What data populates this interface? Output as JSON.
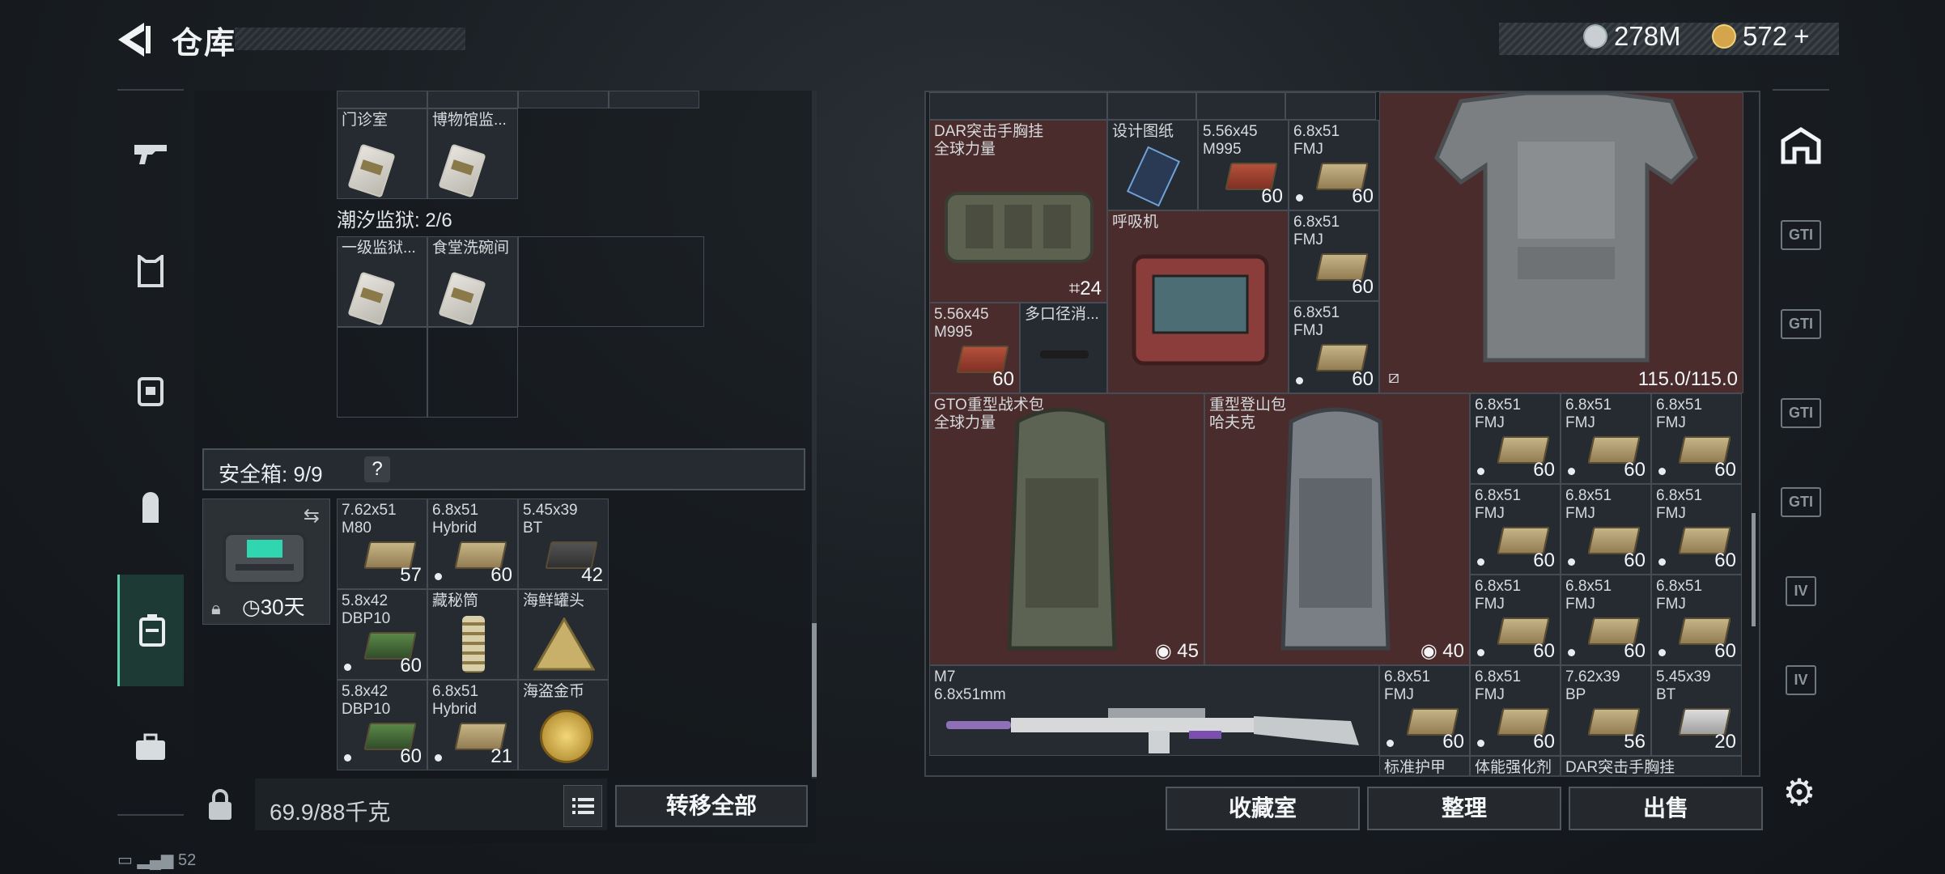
{
  "header": {
    "title": "仓库"
  },
  "currency": {
    "silver": "278M",
    "gold": "572",
    "gold_add": "+"
  },
  "leftnav": {
    "items": [
      "gun-icon",
      "armor-icon",
      "rig-icon",
      "backpack-icon",
      "case-icon",
      "toolbox-icon"
    ]
  },
  "left_panel": {
    "top_cells": [
      {
        "label": "门诊室"
      },
      {
        "label": "博物馆监..."
      }
    ],
    "group_title": "潮汐监狱: 2/6",
    "group_cells": [
      {
        "label": "一级监狱..."
      },
      {
        "label": "食堂洗碗间"
      }
    ],
    "safe_box": {
      "title": "安全箱: 9/9",
      "help": "?",
      "timer": "30天"
    },
    "safe_items": [
      {
        "label": "7.62x51\nM80",
        "count": "57",
        "dot": false
      },
      {
        "label": "6.8x51\nHybrid",
        "count": "60",
        "dot": true
      },
      {
        "label": "5.45x39\nBT",
        "count": "42",
        "dot": false
      },
      {
        "label": "5.8x42\nDBP10",
        "count": "60",
        "dot": true
      },
      {
        "label": "藏秘筒",
        "count": "",
        "dot": false
      },
      {
        "label": "海鲜罐头",
        "count": "",
        "dot": false
      },
      {
        "label": "5.8x42\nDBP10",
        "count": "60",
        "dot": true
      },
      {
        "label": "6.8x51\nHybrid",
        "count": "21",
        "dot": true
      },
      {
        "label": "海盗金币",
        "count": "",
        "dot": false
      }
    ],
    "weight": "69.9/88千克",
    "transfer_all": "转移全部"
  },
  "right_panel": {
    "top_row_labels": [],
    "chest_rig": {
      "label": "DAR突击手胸挂\n全球力量",
      "count": "24"
    },
    "blueprint": {
      "label": "设计图纸"
    },
    "ammo_m995_a": {
      "label": "5.56x45\nM995",
      "count": "60"
    },
    "fmj_1": {
      "label": "6.8x51\nFMJ",
      "count": "60"
    },
    "respirator": {
      "label": "呼吸机"
    },
    "fmj_2": {
      "label": "6.8x51\nFMJ",
      "count": "60"
    },
    "ammo_m995_b": {
      "label": "5.56x45\nM995",
      "count": "60"
    },
    "suppressor": {
      "label": "多口径消..."
    },
    "fmj_3": {
      "label": "6.8x51\nFMJ",
      "count": "60"
    },
    "armor": {
      "durability": "115.0/115.0"
    },
    "backpack_gto": {
      "label": "GTO重型战术包\n全球力量",
      "count": "45"
    },
    "backpack_hafuke": {
      "label": "重型登山包\n哈夫克",
      "count": "40"
    },
    "fmj_grid": [
      {
        "label": "6.8x51\nFMJ",
        "count": "60"
      },
      {
        "label": "6.8x51\nFMJ",
        "count": "60"
      },
      {
        "label": "6.8x51\nFMJ",
        "count": "60"
      },
      {
        "label": "6.8x51\nFMJ",
        "count": "60"
      },
      {
        "label": "6.8x51\nFMJ",
        "count": "60"
      },
      {
        "label": "6.8x51\nFMJ",
        "count": "60"
      },
      {
        "label": "6.8x51\nFMJ",
        "count": "60"
      },
      {
        "label": "6.8x51\nFMJ",
        "count": "60"
      },
      {
        "label": "6.8x51\nFMJ",
        "count": "60"
      }
    ],
    "rifle": {
      "label": "M7\n6.8x51mm"
    },
    "bottom_ammo": [
      {
        "label": "6.8x51\nFMJ",
        "count": "60",
        "dot": true
      },
      {
        "label": "6.8x51\nFMJ",
        "count": "60",
        "dot": true
      },
      {
        "label": "7.62x39\nBP",
        "count": "56",
        "dot": false
      },
      {
        "label": "5.45x39\nBT",
        "count": "20",
        "dot": false
      }
    ],
    "partial_labels": [
      "标准护甲",
      "体能强化剂",
      "DAR突击手胸挂"
    ]
  },
  "actions": {
    "collection": "收藏室",
    "sort": "整理",
    "sell": "出售"
  },
  "rightnav": {
    "gti_label": "GTI",
    "iv_label": "IV"
  },
  "status": {
    "signal": "52"
  }
}
